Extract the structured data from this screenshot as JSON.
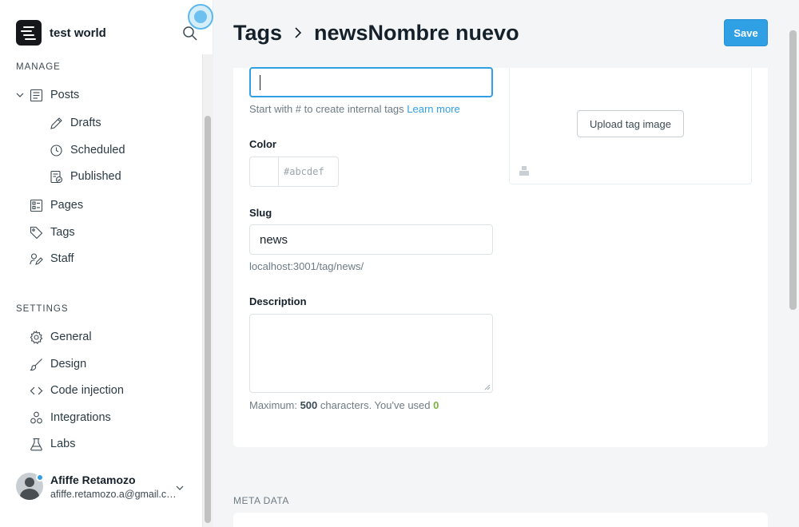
{
  "sidebar": {
    "site_name": "test world",
    "manage_heading": "MANAGE",
    "settings_heading": "SETTINGS",
    "posts": "Posts",
    "drafts": "Drafts",
    "scheduled": "Scheduled",
    "published": "Published",
    "pages": "Pages",
    "tags": "Tags",
    "staff": "Staff",
    "general": "General",
    "design": "Design",
    "code_injection": "Code injection",
    "integrations": "Integrations",
    "labs": "Labs",
    "user_name": "Afiffe Retamozo",
    "user_email": "afiffe.retamozo.a@gmail.com"
  },
  "header": {
    "crumb_parent": "Tags",
    "crumb_current": "newsNombre nuevo",
    "save_label": "Save"
  },
  "form": {
    "name_value": "",
    "name_help": "Start with # to create internal tags",
    "learn_more": "Learn more",
    "color_label": "Color",
    "color_placeholder": "#abcdef",
    "slug_label": "Slug",
    "slug_value": "news",
    "slug_url": "localhost:3001/tag/news/",
    "description_label": "Description",
    "description_value": "",
    "count_prefix": "Maximum: ",
    "count_max": "500",
    "count_middle": " characters. You've used ",
    "count_used": "0",
    "upload_label": "Upload tag image"
  },
  "meta": {
    "heading": "META DATA"
  },
  "colors": {
    "accent": "#30a0e5",
    "count_used": "#7cb342"
  }
}
